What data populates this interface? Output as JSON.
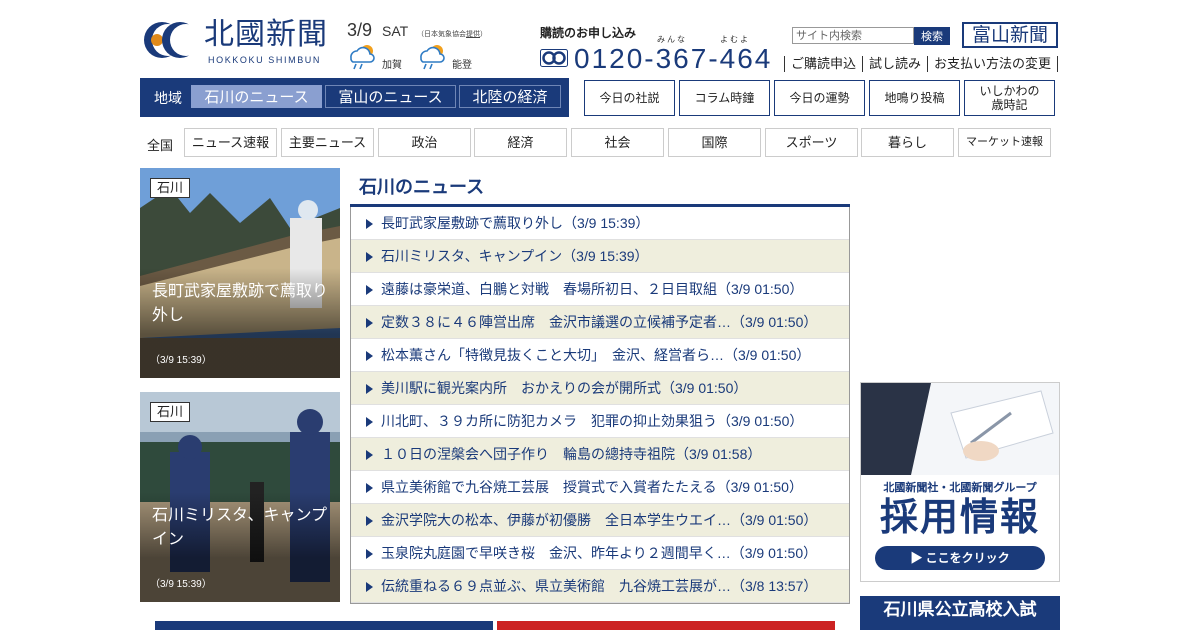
{
  "logo": {
    "title": "北國新聞",
    "sub": "HOKKOKU SHIMBUN"
  },
  "date": {
    "num": "3/9",
    "day": "SAT",
    "note_prefix": "（日本気象協会",
    "note_link": "提供",
    "note_suffix": "）"
  },
  "weather": [
    {
      "area": "加賀",
      "icon": "rain-sun-icon"
    },
    {
      "area": "能登",
      "icon": "rain-sun-icon"
    }
  ],
  "subscribe": {
    "title": "購読のお申し込み",
    "ruby_mina": "みんな",
    "ruby_yoyo": "よむよ",
    "phone": "0120-367-464"
  },
  "search": {
    "placeholder": "サイト内検索",
    "button": "検索"
  },
  "toyama_link": "富山新聞",
  "util_links": [
    "ご購読申込",
    "試し読み",
    "お支払い方法の変更"
  ],
  "region_nav": {
    "label": "地域",
    "tabs": [
      "石川のニュース",
      "富山のニュース",
      "北陸の経済"
    ]
  },
  "feature_buttons": [
    "今日の社説",
    "コラム時鐘",
    "今日の運勢",
    "地鳴り投稿",
    "いしかわの\n歳時記"
  ],
  "categories": {
    "label": "全国",
    "tabs": [
      "ニュース速報",
      "主要ニュース",
      "政治",
      "経済",
      "社会",
      "国際",
      "スポーツ",
      "暮らし",
      "マーケット速報"
    ]
  },
  "photo_cards": [
    {
      "tag": "石川",
      "caption": "長町武家屋敷跡で薦取り外し",
      "time": "（3/9 15:39）"
    },
    {
      "tag": "石川",
      "caption": "石川ミリスタ、キャンプイン",
      "time": "（3/9 15:39）"
    }
  ],
  "news": {
    "heading": "石川のニュース",
    "items": [
      "長町武家屋敷跡で薦取り外し（3/9 15:39）",
      "石川ミリスタ、キャンプイン（3/9 15:39）",
      "遠藤は豪栄道、白鵬と対戦　春場所初日、２日目取組（3/9 01:50）",
      "定数３８に４６陣営出席　金沢市議選の立候補予定者…（3/9 01:50）",
      "松本薫さん「特徴見抜くこと大切」　金沢、経営者ら…（3/9 01:50）",
      "美川駅に観光案内所　おかえりの会が開所式（3/9 01:50）",
      "川北町、３９カ所に防犯カメラ　犯罪の抑止効果狙う（3/9 01:50）",
      "１０日の涅槃会へ団子作り　輪島の總持寺祖院（3/9 01:58）",
      "県立美術館で九谷焼工芸展　授賞式で入賞者たたえる（3/9 01:50）",
      "金沢学院大の松本、伊藤が初優勝　全日本学生ウエイ…（3/9 01:50）",
      "玉泉院丸庭園で早咲き桜　金沢、昨年より２週間早く…（3/9 01:50）",
      "伝統重ねる６９点並ぶ、県立美術館　九谷焼工芸展が…（3/8 13:57）"
    ]
  },
  "ads": {
    "recruit_line1": "北國新聞社・北國新聞グループ",
    "recruit_line2": "採用情報",
    "recruit_button": "▶ ここをクリック",
    "exam": "石川県公立高校入試"
  },
  "colors": {
    "brand": "#1a3a7a",
    "alt_row": "#efeedd"
  }
}
